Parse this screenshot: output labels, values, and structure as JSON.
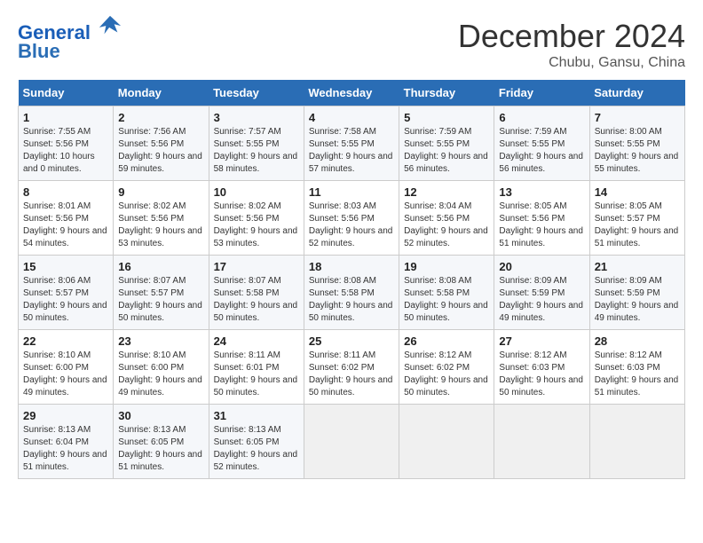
{
  "header": {
    "logo_line1": "General",
    "logo_line2": "Blue",
    "title": "December 2024",
    "subtitle": "Chubu, Gansu, China"
  },
  "weekdays": [
    "Sunday",
    "Monday",
    "Tuesday",
    "Wednesday",
    "Thursday",
    "Friday",
    "Saturday"
  ],
  "weeks": [
    [
      {
        "day": "1",
        "sunrise": "Sunrise: 7:55 AM",
        "sunset": "Sunset: 5:56 PM",
        "daylight": "Daylight: 10 hours and 0 minutes."
      },
      {
        "day": "2",
        "sunrise": "Sunrise: 7:56 AM",
        "sunset": "Sunset: 5:56 PM",
        "daylight": "Daylight: 9 hours and 59 minutes."
      },
      {
        "day": "3",
        "sunrise": "Sunrise: 7:57 AM",
        "sunset": "Sunset: 5:55 PM",
        "daylight": "Daylight: 9 hours and 58 minutes."
      },
      {
        "day": "4",
        "sunrise": "Sunrise: 7:58 AM",
        "sunset": "Sunset: 5:55 PM",
        "daylight": "Daylight: 9 hours and 57 minutes."
      },
      {
        "day": "5",
        "sunrise": "Sunrise: 7:59 AM",
        "sunset": "Sunset: 5:55 PM",
        "daylight": "Daylight: 9 hours and 56 minutes."
      },
      {
        "day": "6",
        "sunrise": "Sunrise: 7:59 AM",
        "sunset": "Sunset: 5:55 PM",
        "daylight": "Daylight: 9 hours and 56 minutes."
      },
      {
        "day": "7",
        "sunrise": "Sunrise: 8:00 AM",
        "sunset": "Sunset: 5:55 PM",
        "daylight": "Daylight: 9 hours and 55 minutes."
      }
    ],
    [
      {
        "day": "8",
        "sunrise": "Sunrise: 8:01 AM",
        "sunset": "Sunset: 5:56 PM",
        "daylight": "Daylight: 9 hours and 54 minutes."
      },
      {
        "day": "9",
        "sunrise": "Sunrise: 8:02 AM",
        "sunset": "Sunset: 5:56 PM",
        "daylight": "Daylight: 9 hours and 53 minutes."
      },
      {
        "day": "10",
        "sunrise": "Sunrise: 8:02 AM",
        "sunset": "Sunset: 5:56 PM",
        "daylight": "Daylight: 9 hours and 53 minutes."
      },
      {
        "day": "11",
        "sunrise": "Sunrise: 8:03 AM",
        "sunset": "Sunset: 5:56 PM",
        "daylight": "Daylight: 9 hours and 52 minutes."
      },
      {
        "day": "12",
        "sunrise": "Sunrise: 8:04 AM",
        "sunset": "Sunset: 5:56 PM",
        "daylight": "Daylight: 9 hours and 52 minutes."
      },
      {
        "day": "13",
        "sunrise": "Sunrise: 8:05 AM",
        "sunset": "Sunset: 5:56 PM",
        "daylight": "Daylight: 9 hours and 51 minutes."
      },
      {
        "day": "14",
        "sunrise": "Sunrise: 8:05 AM",
        "sunset": "Sunset: 5:57 PM",
        "daylight": "Daylight: 9 hours and 51 minutes."
      }
    ],
    [
      {
        "day": "15",
        "sunrise": "Sunrise: 8:06 AM",
        "sunset": "Sunset: 5:57 PM",
        "daylight": "Daylight: 9 hours and 50 minutes."
      },
      {
        "day": "16",
        "sunrise": "Sunrise: 8:07 AM",
        "sunset": "Sunset: 5:57 PM",
        "daylight": "Daylight: 9 hours and 50 minutes."
      },
      {
        "day": "17",
        "sunrise": "Sunrise: 8:07 AM",
        "sunset": "Sunset: 5:58 PM",
        "daylight": "Daylight: 9 hours and 50 minutes."
      },
      {
        "day": "18",
        "sunrise": "Sunrise: 8:08 AM",
        "sunset": "Sunset: 5:58 PM",
        "daylight": "Daylight: 9 hours and 50 minutes."
      },
      {
        "day": "19",
        "sunrise": "Sunrise: 8:08 AM",
        "sunset": "Sunset: 5:58 PM",
        "daylight": "Daylight: 9 hours and 50 minutes."
      },
      {
        "day": "20",
        "sunrise": "Sunrise: 8:09 AM",
        "sunset": "Sunset: 5:59 PM",
        "daylight": "Daylight: 9 hours and 49 minutes."
      },
      {
        "day": "21",
        "sunrise": "Sunrise: 8:09 AM",
        "sunset": "Sunset: 5:59 PM",
        "daylight": "Daylight: 9 hours and 49 minutes."
      }
    ],
    [
      {
        "day": "22",
        "sunrise": "Sunrise: 8:10 AM",
        "sunset": "Sunset: 6:00 PM",
        "daylight": "Daylight: 9 hours and 49 minutes."
      },
      {
        "day": "23",
        "sunrise": "Sunrise: 8:10 AM",
        "sunset": "Sunset: 6:00 PM",
        "daylight": "Daylight: 9 hours and 49 minutes."
      },
      {
        "day": "24",
        "sunrise": "Sunrise: 8:11 AM",
        "sunset": "Sunset: 6:01 PM",
        "daylight": "Daylight: 9 hours and 50 minutes."
      },
      {
        "day": "25",
        "sunrise": "Sunrise: 8:11 AM",
        "sunset": "Sunset: 6:02 PM",
        "daylight": "Daylight: 9 hours and 50 minutes."
      },
      {
        "day": "26",
        "sunrise": "Sunrise: 8:12 AM",
        "sunset": "Sunset: 6:02 PM",
        "daylight": "Daylight: 9 hours and 50 minutes."
      },
      {
        "day": "27",
        "sunrise": "Sunrise: 8:12 AM",
        "sunset": "Sunset: 6:03 PM",
        "daylight": "Daylight: 9 hours and 50 minutes."
      },
      {
        "day": "28",
        "sunrise": "Sunrise: 8:12 AM",
        "sunset": "Sunset: 6:03 PM",
        "daylight": "Daylight: 9 hours and 51 minutes."
      }
    ],
    [
      {
        "day": "29",
        "sunrise": "Sunrise: 8:13 AM",
        "sunset": "Sunset: 6:04 PM",
        "daylight": "Daylight: 9 hours and 51 minutes."
      },
      {
        "day": "30",
        "sunrise": "Sunrise: 8:13 AM",
        "sunset": "Sunset: 6:05 PM",
        "daylight": "Daylight: 9 hours and 51 minutes."
      },
      {
        "day": "31",
        "sunrise": "Sunrise: 8:13 AM",
        "sunset": "Sunset: 6:05 PM",
        "daylight": "Daylight: 9 hours and 52 minutes."
      },
      null,
      null,
      null,
      null
    ]
  ]
}
